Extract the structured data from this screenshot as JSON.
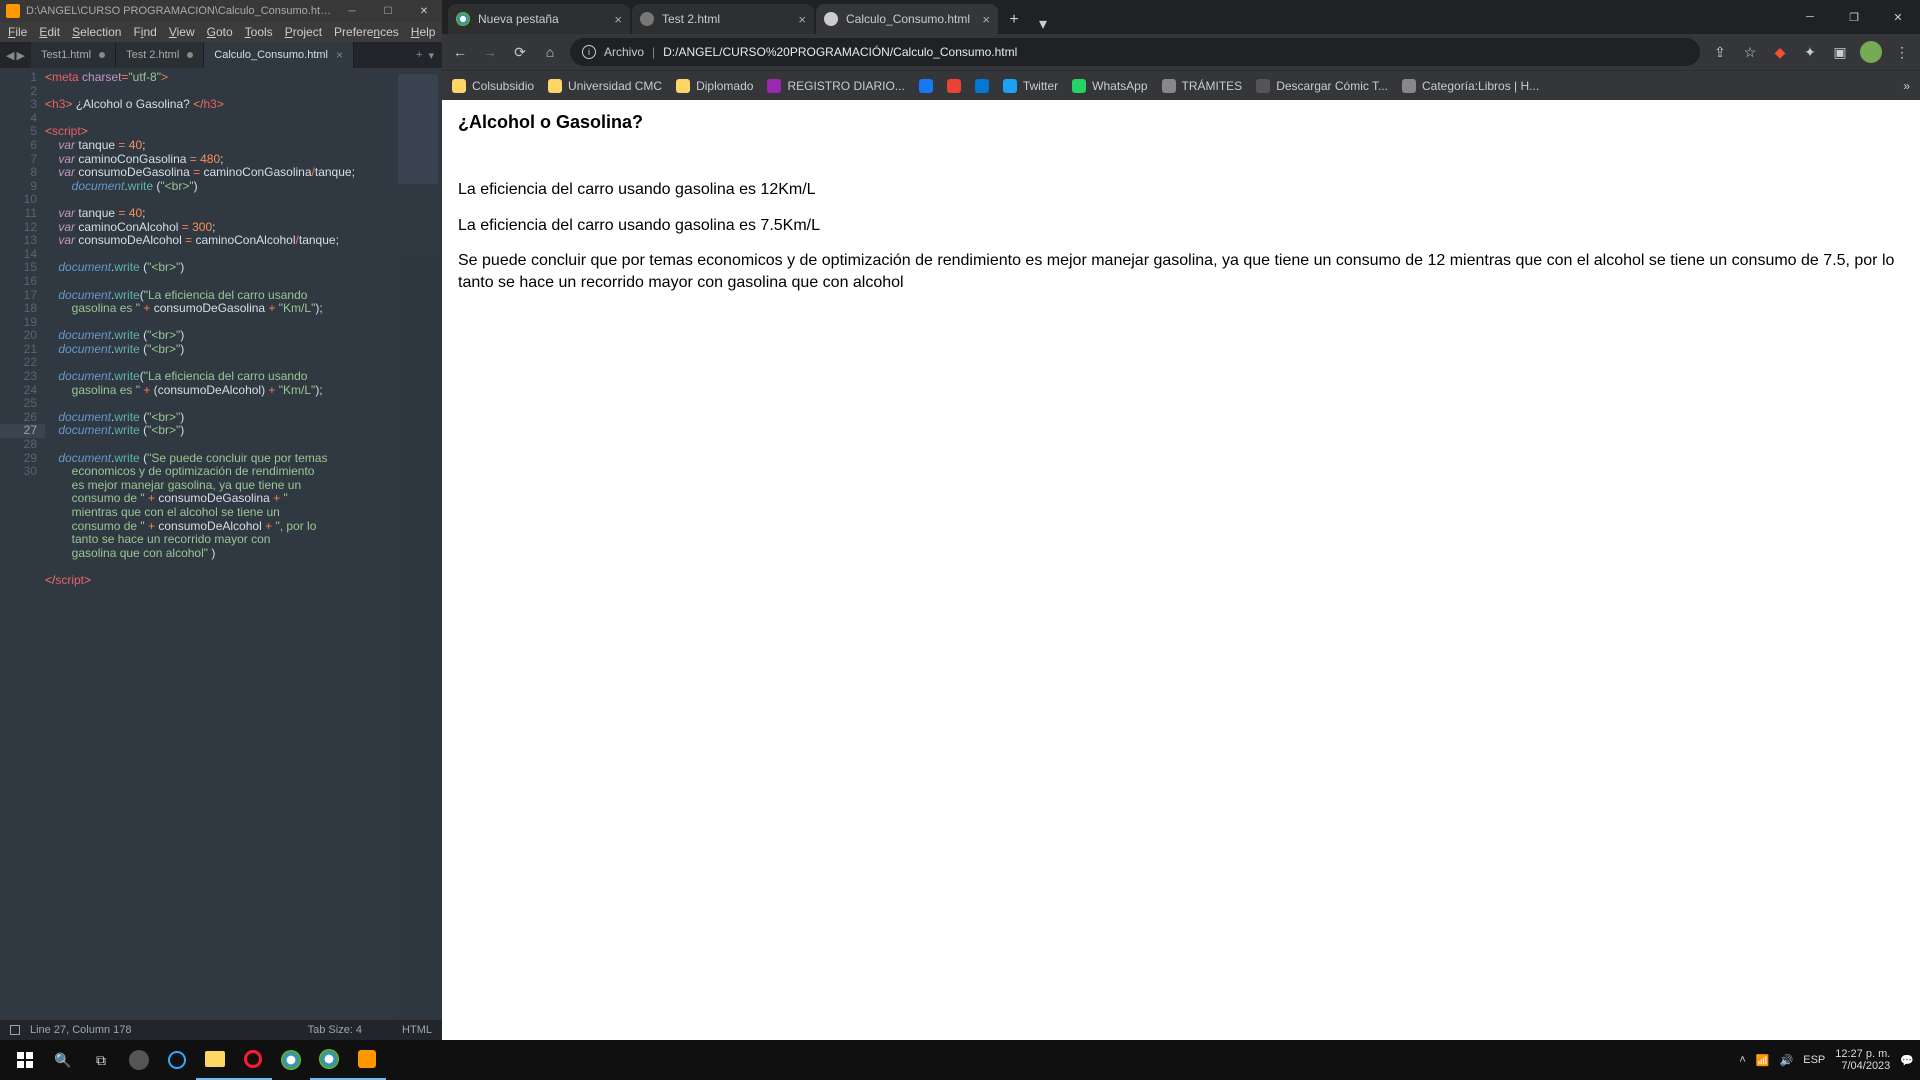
{
  "sublime": {
    "title": "D:\\ANGEL\\CURSO PROGRAMACIÓN\\Calculo_Consumo.html - Sublime Text...",
    "menu": [
      "File",
      "Edit",
      "Selection",
      "Find",
      "View",
      "Goto",
      "Tools",
      "Project",
      "Preferences",
      "Help"
    ],
    "tabs": [
      {
        "label": "Test1.html",
        "active": false,
        "dirty": true
      },
      {
        "label": "Test 2.html",
        "active": false,
        "dirty": true
      },
      {
        "label": "Calculo_Consumo.html",
        "active": true,
        "dirty": false
      }
    ],
    "status_left": "Line 27, Column 178",
    "status_mid": "Tab Size: 4",
    "status_right": "HTML",
    "lines": [
      1,
      2,
      3,
      4,
      5,
      6,
      7,
      8,
      9,
      10,
      11,
      12,
      13,
      14,
      15,
      16,
      17,
      18,
      19,
      20,
      21,
      22,
      23,
      24,
      25,
      26,
      27,
      28,
      29,
      30
    ],
    "active_line": 27
  },
  "chrome": {
    "tabs": [
      {
        "label": "Nueva pestaña",
        "icon": "chrome",
        "active": false
      },
      {
        "label": "Test 2.html",
        "icon": "globe",
        "active": false
      },
      {
        "label": "Calculo_Consumo.html",
        "icon": "file",
        "active": true
      }
    ],
    "addr_label": "Archivo",
    "url": "D:/ANGEL/CURSO%20PROGRAMACIÓN/Calculo_Consumo.html",
    "bookmarks": [
      {
        "label": "Colsubsidio",
        "color": "#fdd663",
        "type": "folder"
      },
      {
        "label": "Universidad CMC",
        "color": "#fdd663",
        "type": "folder"
      },
      {
        "label": "Diplomado",
        "color": "#fdd663",
        "type": "folder"
      },
      {
        "label": "REGISTRO DIARIO...",
        "color": "#9c27b0",
        "type": "link"
      },
      {
        "label": "",
        "color": "#1877f2",
        "type": "fb"
      },
      {
        "label": "",
        "color": "#ea4335",
        "type": "g"
      },
      {
        "label": "",
        "color": "#0078d4",
        "type": "o"
      },
      {
        "label": "Twitter",
        "color": "#1da1f2",
        "type": "link"
      },
      {
        "label": "WhatsApp",
        "color": "#25d366",
        "type": "link"
      },
      {
        "label": "TRÁMITES",
        "color": "#888",
        "type": "link"
      },
      {
        "label": "Descargar Cómic  T...",
        "color": "#555",
        "type": "link"
      },
      {
        "label": "Categoría:Libros | H...",
        "color": "#888",
        "type": "link"
      }
    ]
  },
  "page": {
    "title": "¿Alcohol o Gasolina?",
    "line1": "La eficiencia del carro usando gasolina es 12Km/L",
    "line2": "La eficiencia del carro usando gasolina es 7.5Km/L",
    "line3": "Se puede concluir que por temas economicos y de optimización de rendimiento es mejor manejar gasolina, ya que tiene un consumo de 12 mientras que con el alcohol se tiene un consumo de 7.5, por lo tanto se hace un recorrido mayor con gasolina que con alcohol"
  },
  "taskbar": {
    "lang": "ESP",
    "time": "12:27 p. m.",
    "date": "7/04/2023"
  }
}
